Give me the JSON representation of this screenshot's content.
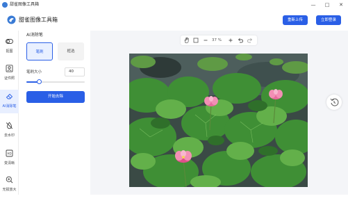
{
  "window": {
    "title": "甜雀图像工具箱",
    "controls": {
      "minimize": "—",
      "maximize": "□",
      "close": "✕"
    }
  },
  "header": {
    "app_name": "甜雀图像工具箱",
    "reupload_label": "重新上传",
    "download_label": "立即登录"
  },
  "nav": {
    "items": [
      {
        "label": "抠图",
        "icon": "toggle-icon"
      },
      {
        "label": "证件照",
        "icon": "id-photo-icon"
      },
      {
        "label": "AI消除笔",
        "icon": "eraser-icon",
        "active": true
      },
      {
        "label": "去水印",
        "icon": "watermark-off-icon"
      },
      {
        "label": "变清晰",
        "icon": "hd-icon"
      },
      {
        "label": "无损放大",
        "icon": "zoom-in-icon"
      }
    ]
  },
  "panel": {
    "title": "AI消除笔",
    "mode_brush": "笔刷",
    "mode_lasso": "框选",
    "brush_size_label": "笔刷大小",
    "brush_size_value": "40",
    "brush_size_fraction": 0.22,
    "start_label": "开始去除"
  },
  "toolbar": {
    "zoom": "37 %"
  },
  "colors": {
    "accent": "#2a5fe6",
    "active_bg": "#e8efff"
  }
}
